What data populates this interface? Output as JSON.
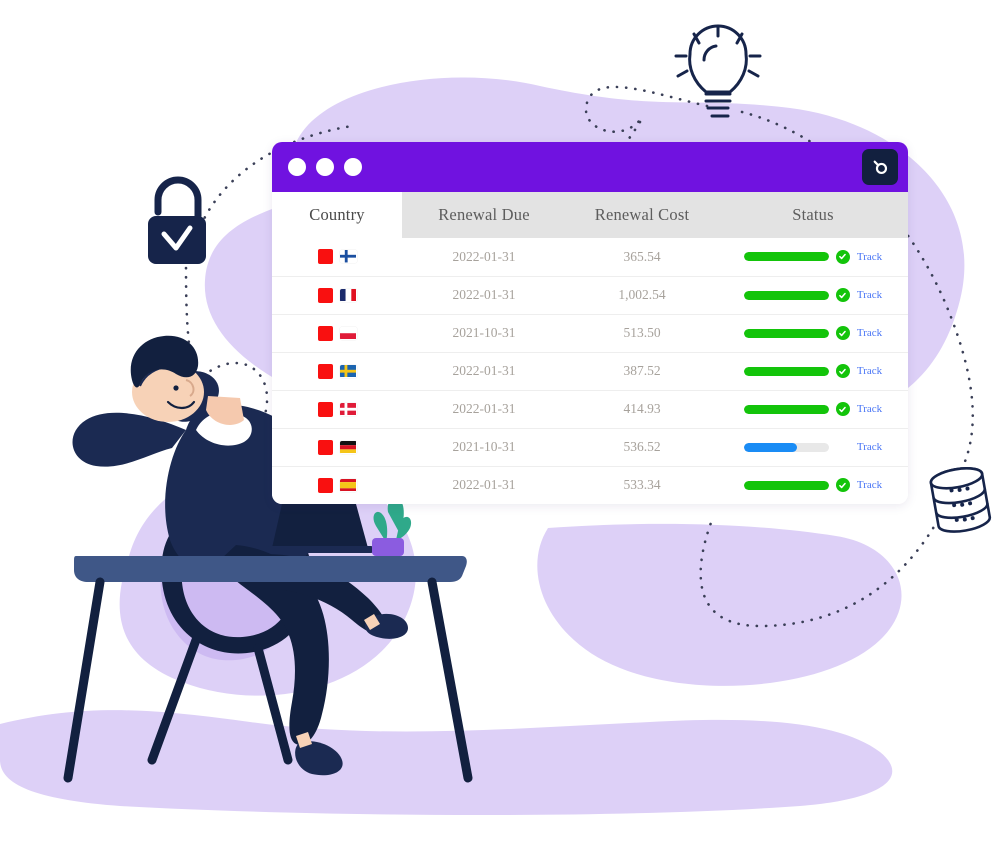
{
  "window": {
    "title_dots": [
      "dot-1",
      "dot-2",
      "dot-3"
    ],
    "search_icon": "search-icon",
    "header_color": "#7012e0",
    "search_button_color": "#12203f"
  },
  "table": {
    "columns": [
      {
        "key": "country",
        "label": "Country",
        "active": true
      },
      {
        "key": "renewal_due",
        "label": "Renewal Due",
        "active": false
      },
      {
        "key": "renewal_cost",
        "label": "Renewal Cost",
        "active": false
      },
      {
        "key": "status",
        "label": "Status",
        "active": false
      }
    ],
    "action_label": "Track",
    "rows": [
      {
        "country": "Finland",
        "flag": "fi",
        "renewal_due": "2022-01-31",
        "renewal_cost": "365.54",
        "progress": 100,
        "bar_color": "#13c40a",
        "complete": true
      },
      {
        "country": "France",
        "flag": "fr",
        "renewal_due": "2022-01-31",
        "renewal_cost": "1,002.54",
        "progress": 100,
        "bar_color": "#13c40a",
        "complete": true
      },
      {
        "country": "Poland",
        "flag": "pl",
        "renewal_due": "2021-10-31",
        "renewal_cost": "513.50",
        "progress": 100,
        "bar_color": "#13c40a",
        "complete": true
      },
      {
        "country": "Sweden",
        "flag": "se",
        "renewal_due": "2022-01-31",
        "renewal_cost": "387.52",
        "progress": 100,
        "bar_color": "#13c40a",
        "complete": true
      },
      {
        "country": "Denmark",
        "flag": "dk",
        "renewal_due": "2022-01-31",
        "renewal_cost": "414.93",
        "progress": 100,
        "bar_color": "#13c40a",
        "complete": true
      },
      {
        "country": "Germany",
        "flag": "de",
        "renewal_due": "2021-10-31",
        "renewal_cost": "536.52",
        "progress": 62,
        "bar_color": "#1a8cf5",
        "complete": false
      },
      {
        "country": "Spain",
        "flag": "es",
        "renewal_due": "2022-01-31",
        "renewal_cost": "533.34",
        "progress": 100,
        "bar_color": "#13c40a",
        "complete": true
      }
    ]
  },
  "illustration": {
    "background_blob_color": "#ddd0f7",
    "accent_blob_color": "#cdbaf2",
    "dark_navy": "#16244a",
    "desk_color": "#3f5787",
    "icons": [
      {
        "name": "padlock-check-icon",
        "label": "Secure"
      },
      {
        "name": "lightbulb-icon",
        "label": "Idea"
      },
      {
        "name": "database-icon",
        "label": "Data"
      }
    ],
    "character": {
      "name": "relaxed-person-at-desk",
      "objects": [
        "laptop",
        "cactus-plant",
        "chair",
        "desk"
      ]
    }
  }
}
